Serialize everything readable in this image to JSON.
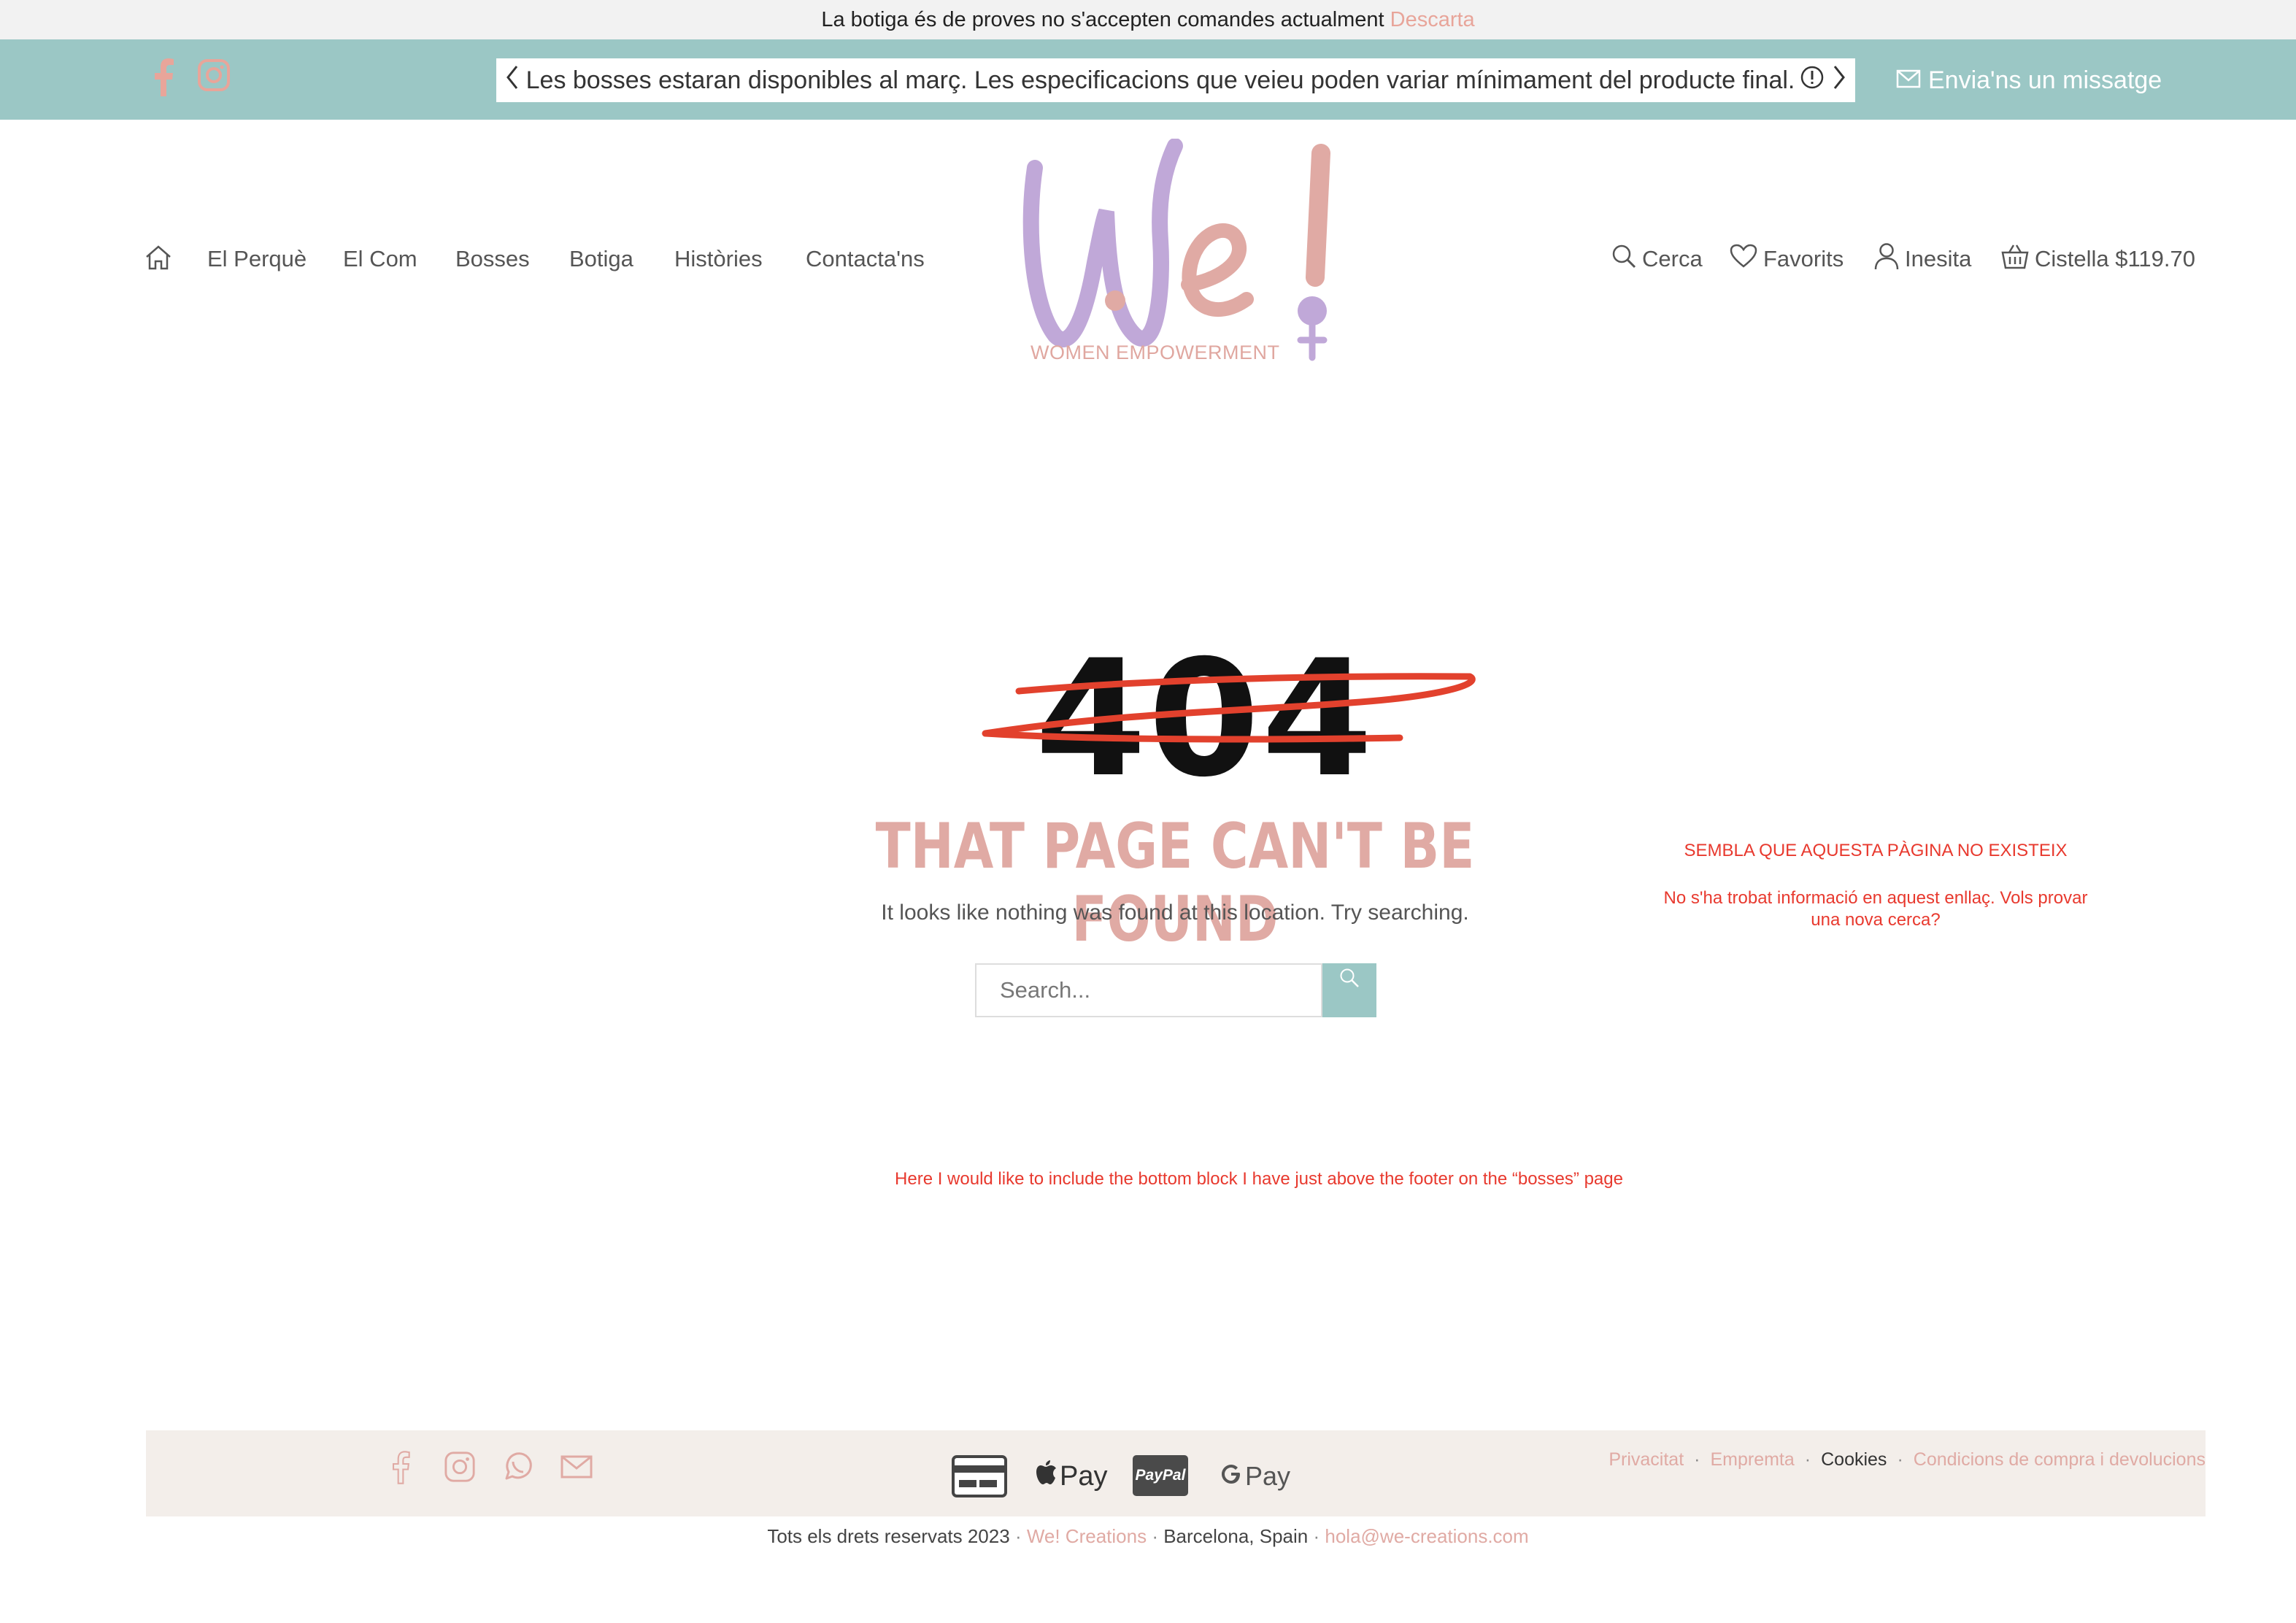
{
  "notice": {
    "text": "La botiga és de proves no s'accepten comandes actualment",
    "dismiss": "Descarta"
  },
  "topbar": {
    "announcement": "Les bosses estaran disponibles al març. Les especificacions que veieu poden variar mínimament del producte final.",
    "contact": "Envia'ns un missatge"
  },
  "nav": {
    "items": [
      "El Perquè",
      "El Com",
      "Bosses",
      "Botiga",
      "Històries",
      "Contacta'ns"
    ]
  },
  "logo": {
    "tagline": "WOMEN EMPOWERMENT"
  },
  "header_right": {
    "search": "Cerca",
    "favorites": "Favorits",
    "account": "Inesita",
    "cart": "Cistella $119.70"
  },
  "error": {
    "code": "404",
    "headline": "THAT PAGE CAN'T BE FOUND",
    "subline": "It looks like nothing was found at this location. Try searching.",
    "search_placeholder": "Search..."
  },
  "annotations": {
    "title": "SEMBLA QUE AQUESTA PÀGINA NO EXISTEIX",
    "body": "No  s'ha trobat informació en aquest enllaç. Vols provar una nova cerca?",
    "note": "Here  I would like to include the bottom block I have just above the footer on the “bosses” page"
  },
  "payments": {
    "paypal": "PayPal",
    "applepay": "Pay",
    "gpay": "Pay"
  },
  "footer": {
    "links": [
      "Privacitat",
      "Empremta",
      "Cookies",
      "Condicions de compra i devolucions"
    ],
    "rights": "Tots els drets reservats 2023",
    "brand": "We! Creations",
    "location": "Barcelona, Spain",
    "email": "hola@we-creations.com"
  },
  "colors": {
    "teal": "#9bc7c5",
    "pink": "#e0aaa4",
    "red_note": "#e8392e",
    "lilac": "#c0a8d8"
  }
}
